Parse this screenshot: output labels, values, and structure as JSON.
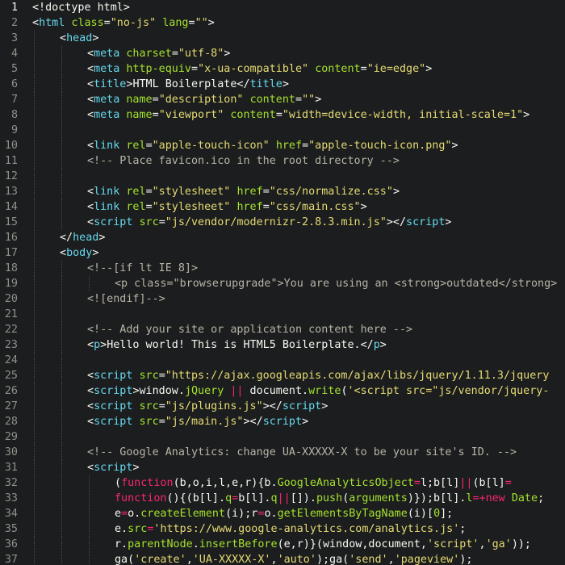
{
  "editor": {
    "current_line": 1,
    "colors": {
      "background": "#1b1d1e",
      "line_number": "#8f908a",
      "tag": "#66d9ef",
      "attribute": "#a6e22e",
      "string": "#e6db74",
      "comment": "#b8b5a8",
      "keyword": "#f92672",
      "text": "#f8f8f2"
    },
    "lines": [
      {
        "n": "1",
        "indent": 0,
        "tokens": [
          [
            "b",
            "<!"
          ],
          [
            "p",
            "doctype html"
          ],
          [
            "b",
            ">"
          ]
        ]
      },
      {
        "n": "2",
        "indent": 0,
        "tokens": [
          [
            "b",
            "<"
          ],
          [
            "t",
            "html"
          ],
          [
            "p",
            " "
          ],
          [
            "a",
            "class"
          ],
          [
            "p",
            "="
          ],
          [
            "s",
            "\"no-js\""
          ],
          [
            "p",
            " "
          ],
          [
            "a",
            "lang"
          ],
          [
            "p",
            "="
          ],
          [
            "s",
            "\"\""
          ],
          [
            "b",
            ">"
          ]
        ]
      },
      {
        "n": "3",
        "indent": 1,
        "tokens": [
          [
            "b",
            "<"
          ],
          [
            "t",
            "head"
          ],
          [
            "b",
            ">"
          ]
        ]
      },
      {
        "n": "4",
        "indent": 2,
        "tokens": [
          [
            "b",
            "<"
          ],
          [
            "t",
            "meta"
          ],
          [
            "p",
            " "
          ],
          [
            "a",
            "charset"
          ],
          [
            "p",
            "="
          ],
          [
            "s",
            "\"utf-8\""
          ],
          [
            "b",
            ">"
          ]
        ]
      },
      {
        "n": "5",
        "indent": 2,
        "tokens": [
          [
            "b",
            "<"
          ],
          [
            "t",
            "meta"
          ],
          [
            "p",
            " "
          ],
          [
            "a",
            "http-equiv"
          ],
          [
            "p",
            "="
          ],
          [
            "s",
            "\"x-ua-compatible\""
          ],
          [
            "p",
            " "
          ],
          [
            "a",
            "content"
          ],
          [
            "p",
            "="
          ],
          [
            "s",
            "\"ie=edge\""
          ],
          [
            "b",
            ">"
          ]
        ]
      },
      {
        "n": "6",
        "indent": 2,
        "tokens": [
          [
            "b",
            "<"
          ],
          [
            "t",
            "title"
          ],
          [
            "b",
            ">"
          ],
          [
            "p",
            "HTML Boilerplate"
          ],
          [
            "b",
            "</"
          ],
          [
            "t",
            "title"
          ],
          [
            "b",
            ">"
          ]
        ]
      },
      {
        "n": "7",
        "indent": 2,
        "tokens": [
          [
            "b",
            "<"
          ],
          [
            "t",
            "meta"
          ],
          [
            "p",
            " "
          ],
          [
            "a",
            "name"
          ],
          [
            "p",
            "="
          ],
          [
            "s",
            "\"description\""
          ],
          [
            "p",
            " "
          ],
          [
            "a",
            "content"
          ],
          [
            "p",
            "="
          ],
          [
            "s",
            "\"\""
          ],
          [
            "b",
            ">"
          ]
        ]
      },
      {
        "n": "8",
        "indent": 2,
        "tokens": [
          [
            "b",
            "<"
          ],
          [
            "t",
            "meta"
          ],
          [
            "p",
            " "
          ],
          [
            "a",
            "name"
          ],
          [
            "p",
            "="
          ],
          [
            "s",
            "\"viewport\""
          ],
          [
            "p",
            " "
          ],
          [
            "a",
            "content"
          ],
          [
            "p",
            "="
          ],
          [
            "s",
            "\"width=device-width, initial-scale=1\""
          ],
          [
            "b",
            ">"
          ]
        ]
      },
      {
        "n": "9",
        "indent": 2,
        "tokens": []
      },
      {
        "n": "10",
        "indent": 2,
        "tokens": [
          [
            "b",
            "<"
          ],
          [
            "t",
            "link"
          ],
          [
            "p",
            " "
          ],
          [
            "a",
            "rel"
          ],
          [
            "p",
            "="
          ],
          [
            "s",
            "\"apple-touch-icon\""
          ],
          [
            "p",
            " "
          ],
          [
            "a",
            "href"
          ],
          [
            "p",
            "="
          ],
          [
            "s",
            "\"apple-touch-icon.png\""
          ],
          [
            "b",
            ">"
          ]
        ]
      },
      {
        "n": "11",
        "indent": 2,
        "tokens": [
          [
            "c",
            "<!-- Place favicon.ico in the root directory -->"
          ]
        ]
      },
      {
        "n": "12",
        "indent": 2,
        "tokens": []
      },
      {
        "n": "13",
        "indent": 2,
        "tokens": [
          [
            "b",
            "<"
          ],
          [
            "t",
            "link"
          ],
          [
            "p",
            " "
          ],
          [
            "a",
            "rel"
          ],
          [
            "p",
            "="
          ],
          [
            "s",
            "\"stylesheet\""
          ],
          [
            "p",
            " "
          ],
          [
            "a",
            "href"
          ],
          [
            "p",
            "="
          ],
          [
            "s",
            "\"css/normalize.css\""
          ],
          [
            "b",
            ">"
          ]
        ]
      },
      {
        "n": "14",
        "indent": 2,
        "tokens": [
          [
            "b",
            "<"
          ],
          [
            "t",
            "link"
          ],
          [
            "p",
            " "
          ],
          [
            "a",
            "rel"
          ],
          [
            "p",
            "="
          ],
          [
            "s",
            "\"stylesheet\""
          ],
          [
            "p",
            " "
          ],
          [
            "a",
            "href"
          ],
          [
            "p",
            "="
          ],
          [
            "s",
            "\"css/main.css\""
          ],
          [
            "b",
            ">"
          ]
        ]
      },
      {
        "n": "15",
        "indent": 2,
        "tokens": [
          [
            "b",
            "<"
          ],
          [
            "t",
            "script"
          ],
          [
            "p",
            " "
          ],
          [
            "a",
            "src"
          ],
          [
            "p",
            "="
          ],
          [
            "s",
            "\"js/vendor/modernizr-2.8.3.min.js\""
          ],
          [
            "b",
            "></"
          ],
          [
            "t",
            "script"
          ],
          [
            "b",
            ">"
          ]
        ]
      },
      {
        "n": "16",
        "indent": 1,
        "tokens": [
          [
            "b",
            "</"
          ],
          [
            "t",
            "head"
          ],
          [
            "b",
            ">"
          ]
        ]
      },
      {
        "n": "17",
        "indent": 1,
        "tokens": [
          [
            "b",
            "<"
          ],
          [
            "t",
            "body"
          ],
          [
            "b",
            ">"
          ]
        ]
      },
      {
        "n": "18",
        "indent": 2,
        "tokens": [
          [
            "c",
            "<!--[if lt IE 8]>"
          ]
        ]
      },
      {
        "n": "19",
        "indent": 3,
        "tokens": [
          [
            "c",
            "<p class=\"browserupgrade\">You are using an <strong>outdated</strong>"
          ]
        ]
      },
      {
        "n": "20",
        "indent": 2,
        "tokens": [
          [
            "c",
            "<![endif]-->"
          ]
        ]
      },
      {
        "n": "21",
        "indent": 2,
        "tokens": []
      },
      {
        "n": "22",
        "indent": 2,
        "tokens": [
          [
            "c",
            "<!-- Add your site or application content here -->"
          ]
        ]
      },
      {
        "n": "23",
        "indent": 2,
        "tokens": [
          [
            "b",
            "<"
          ],
          [
            "t",
            "p"
          ],
          [
            "b",
            ">"
          ],
          [
            "p",
            "Hello world! This is HTML5 Boilerplate."
          ],
          [
            "b",
            "</"
          ],
          [
            "t",
            "p"
          ],
          [
            "b",
            ">"
          ]
        ]
      },
      {
        "n": "24",
        "indent": 2,
        "tokens": []
      },
      {
        "n": "25",
        "indent": 2,
        "tokens": [
          [
            "b",
            "<"
          ],
          [
            "t",
            "script"
          ],
          [
            "p",
            " "
          ],
          [
            "a",
            "src"
          ],
          [
            "p",
            "="
          ],
          [
            "s",
            "\"https://ajax.googleapis.com/ajax/libs/jquery/1.11.3/jquery"
          ]
        ]
      },
      {
        "n": "26",
        "indent": 2,
        "tokens": [
          [
            "b",
            "<"
          ],
          [
            "t",
            "script"
          ],
          [
            "b",
            ">"
          ],
          [
            "p",
            "window."
          ],
          [
            "a",
            "jQuery"
          ],
          [
            "p",
            " "
          ],
          [
            "k",
            "||"
          ],
          [
            "p",
            " document."
          ],
          [
            "a",
            "write"
          ],
          [
            "p",
            "("
          ],
          [
            "s",
            "'<script src=\"js/vendor/jquery-"
          ]
        ]
      },
      {
        "n": "27",
        "indent": 2,
        "tokens": [
          [
            "b",
            "<"
          ],
          [
            "t",
            "script"
          ],
          [
            "p",
            " "
          ],
          [
            "a",
            "src"
          ],
          [
            "p",
            "="
          ],
          [
            "s",
            "\"js/plugins.js\""
          ],
          [
            "b",
            "></"
          ],
          [
            "t",
            "script"
          ],
          [
            "b",
            ">"
          ]
        ]
      },
      {
        "n": "28",
        "indent": 2,
        "tokens": [
          [
            "b",
            "<"
          ],
          [
            "t",
            "script"
          ],
          [
            "p",
            " "
          ],
          [
            "a",
            "src"
          ],
          [
            "p",
            "="
          ],
          [
            "s",
            "\"js/main.js\""
          ],
          [
            "b",
            "></"
          ],
          [
            "t",
            "script"
          ],
          [
            "b",
            ">"
          ]
        ]
      },
      {
        "n": "29",
        "indent": 2,
        "tokens": []
      },
      {
        "n": "30",
        "indent": 2,
        "tokens": [
          [
            "c",
            "<!-- Google Analytics: change UA-XXXXX-X to be your site's ID. -->"
          ]
        ]
      },
      {
        "n": "31",
        "indent": 2,
        "tokens": [
          [
            "b",
            "<"
          ],
          [
            "t",
            "script"
          ],
          [
            "b",
            ">"
          ]
        ]
      },
      {
        "n": "32",
        "indent": 3,
        "tokens": [
          [
            "p",
            "("
          ],
          [
            "k",
            "function"
          ],
          [
            "p",
            "(b,o,i,l,e,r){b."
          ],
          [
            "a",
            "GoogleAnalyticsObject"
          ],
          [
            "k",
            "="
          ],
          [
            "p",
            "l;b[l]"
          ],
          [
            "k",
            "||"
          ],
          [
            "p",
            "(b[l]"
          ],
          [
            "k",
            "="
          ]
        ]
      },
      {
        "n": "33",
        "indent": 3,
        "tokens": [
          [
            "k",
            "function"
          ],
          [
            "p",
            "(){(b[l]."
          ],
          [
            "a",
            "q"
          ],
          [
            "k",
            "="
          ],
          [
            "p",
            "b[l]."
          ],
          [
            "a",
            "q"
          ],
          [
            "k",
            "||"
          ],
          [
            "p",
            "[])."
          ],
          [
            "a",
            "push"
          ],
          [
            "p",
            "("
          ],
          [
            "a",
            "arguments"
          ],
          [
            "p",
            ")});b[l]."
          ],
          [
            "a",
            "l"
          ],
          [
            "k",
            "=+"
          ],
          [
            "k",
            "new"
          ],
          [
            "p",
            " "
          ],
          [
            "a",
            "Date"
          ],
          [
            "p",
            ";"
          ]
        ]
      },
      {
        "n": "34",
        "indent": 3,
        "tokens": [
          [
            "p",
            "e"
          ],
          [
            "k",
            "="
          ],
          [
            "p",
            "o."
          ],
          [
            "a",
            "createElement"
          ],
          [
            "p",
            "(i);r"
          ],
          [
            "k",
            "="
          ],
          [
            "p",
            "o."
          ],
          [
            "a",
            "getElementsByTagName"
          ],
          [
            "p",
            "(i)["
          ],
          [
            "a",
            "0"
          ],
          [
            "p",
            "];"
          ]
        ]
      },
      {
        "n": "35",
        "indent": 3,
        "tokens": [
          [
            "p",
            "e."
          ],
          [
            "a",
            "src"
          ],
          [
            "k",
            "="
          ],
          [
            "s",
            "'https://www.google-analytics.com/analytics.js'"
          ],
          [
            "p",
            ";"
          ]
        ]
      },
      {
        "n": "36",
        "indent": 3,
        "tokens": [
          [
            "p",
            "r."
          ],
          [
            "a",
            "parentNode"
          ],
          [
            "p",
            "."
          ],
          [
            "a",
            "insertBefore"
          ],
          [
            "p",
            "(e,r)}(window,document,"
          ],
          [
            "s",
            "'script'"
          ],
          [
            "p",
            ","
          ],
          [
            "s",
            "'ga'"
          ],
          [
            "p",
            "));"
          ]
        ]
      },
      {
        "n": "37",
        "indent": 3,
        "tokens": [
          [
            "p",
            "ga("
          ],
          [
            "s",
            "'create'"
          ],
          [
            "p",
            ","
          ],
          [
            "s",
            "'UA-XXXXX-X'"
          ],
          [
            "p",
            ","
          ],
          [
            "s",
            "'auto'"
          ],
          [
            "p",
            ");ga("
          ],
          [
            "s",
            "'send'"
          ],
          [
            "p",
            ","
          ],
          [
            "s",
            "'pageview'"
          ],
          [
            "p",
            ");"
          ]
        ]
      }
    ]
  }
}
